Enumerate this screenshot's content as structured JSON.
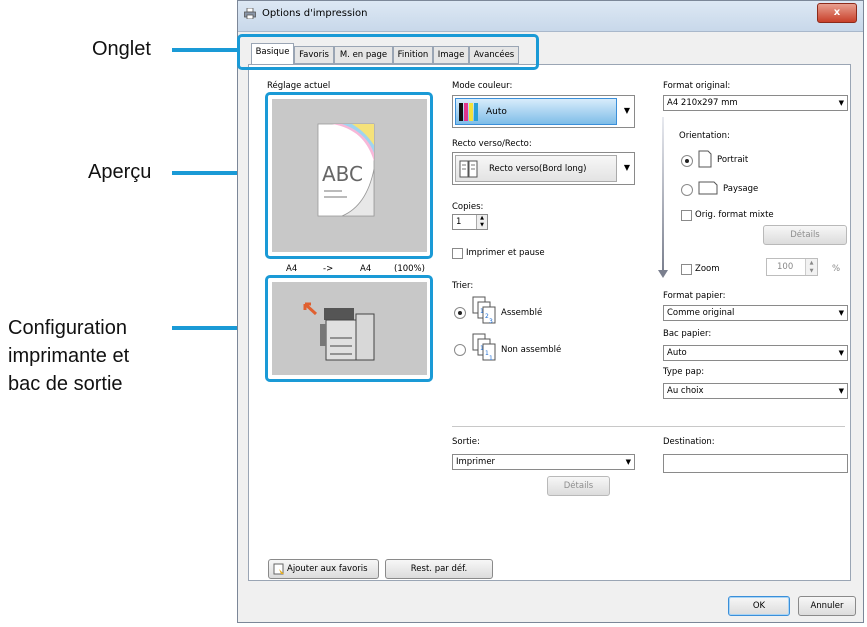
{
  "callouts": {
    "onglet": "Onglet",
    "apercu": "Aperçu",
    "config_line1": "Configuration",
    "config_line2": "imprimante et",
    "config_line3": "bac de sortie"
  },
  "window": {
    "title": "Options d'impression",
    "close": "x"
  },
  "tabs": [
    {
      "label": "Basique"
    },
    {
      "label": "Favoris"
    },
    {
      "label": "M. en page"
    },
    {
      "label": "Finition"
    },
    {
      "label": "Image"
    },
    {
      "label": "Avancées"
    }
  ],
  "left": {
    "current_setting_label": "Réglage actuel",
    "preview_text": "ABC",
    "size_from": "A4",
    "size_arrow": "->",
    "size_to": "A4",
    "size_pct": "(100%)"
  },
  "middle": {
    "color_mode_label": "Mode couleur:",
    "color_mode_value": "Auto",
    "duplex_label": "Recto verso/Recto:",
    "duplex_value": "Recto verso(Bord long)",
    "copies_label": "Copies:",
    "copies_value": "1",
    "print_pause_label": "Imprimer et pause",
    "sort_label": "Trier:",
    "collated_label": "Assemblé",
    "uncollated_label": "Non assemblé"
  },
  "right": {
    "orig_format_label": "Format original:",
    "orig_format_value": "A4 210x297 mm",
    "orientation_label": "Orientation:",
    "portrait_label": "Portrait",
    "landscape_label": "Paysage",
    "mixed_label": "Orig. format mixte",
    "details_label": "Détails",
    "zoom_label": "Zoom",
    "zoom_value": "100",
    "zoom_unit": "%",
    "paper_format_label": "Format papier:",
    "paper_format_value": "Comme original",
    "tray_label": "Bac papier:",
    "tray_value": "Auto",
    "paper_type_label": "Type pap:",
    "paper_type_value": "Au choix"
  },
  "bottom": {
    "output_label": "Sortie:",
    "output_value": "Imprimer",
    "output_details": "Détails",
    "destination_label": "Destination:",
    "destination_value": "",
    "add_favorites": "Ajouter aux favoris",
    "reset_defaults": "Rest. par déf.",
    "ok": "OK",
    "cancel": "Annuler"
  },
  "colors": {
    "callout": "#1a9ad6",
    "accent_button": "#3b8fd9"
  }
}
